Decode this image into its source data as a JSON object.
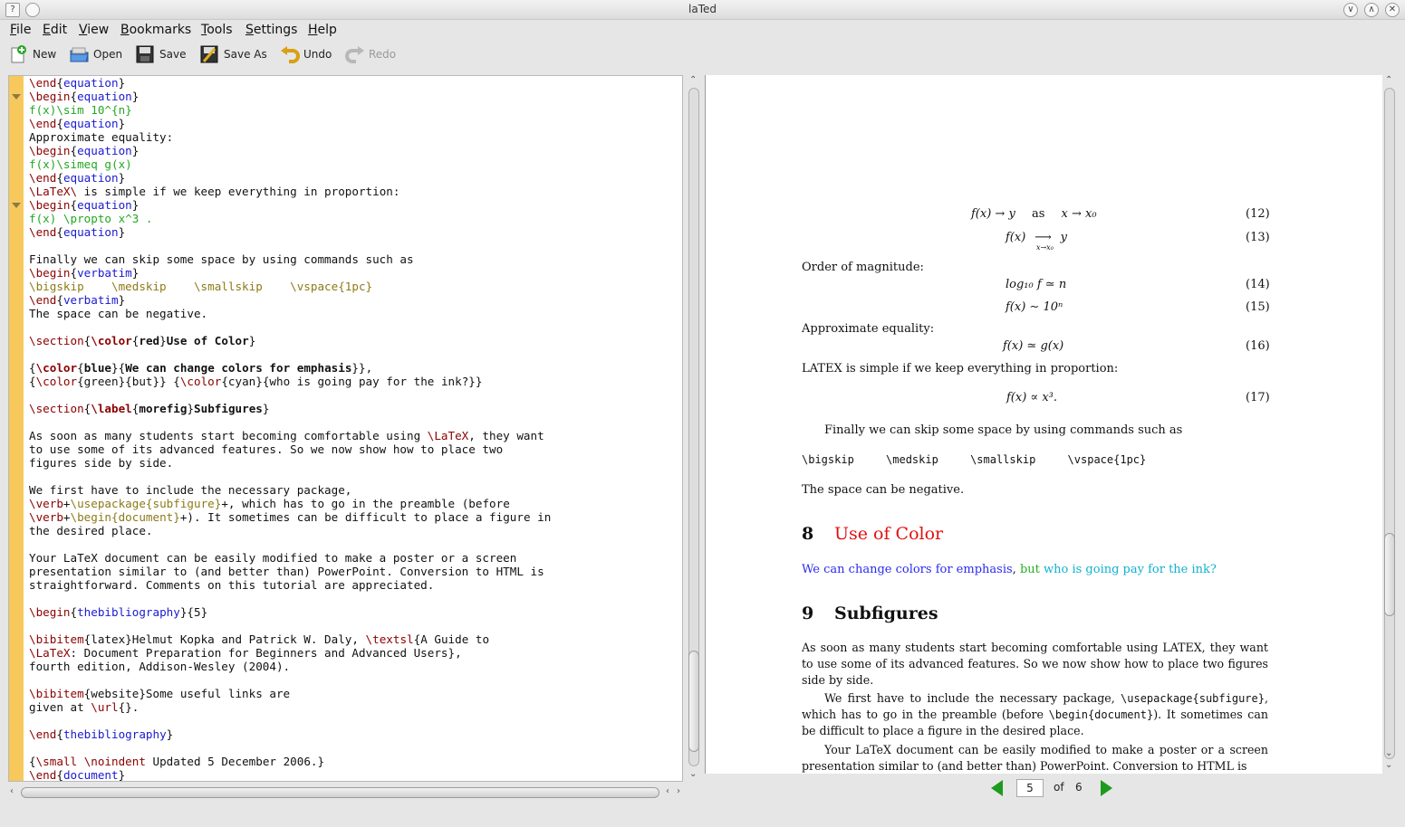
{
  "window": {
    "title": "laTed"
  },
  "titlebar_buttons": {
    "help": "?",
    "minimize": "∨",
    "maximize": "∧",
    "close": "✕"
  },
  "menubar": [
    {
      "mnemonic": "F",
      "rest": "ile"
    },
    {
      "mnemonic": "E",
      "rest": "dit"
    },
    {
      "mnemonic": "V",
      "rest": "iew"
    },
    {
      "mnemonic": "B",
      "rest": "ookmarks"
    },
    {
      "mnemonic": "T",
      "rest": "ools"
    },
    {
      "mnemonic": "S",
      "rest": "ettings"
    },
    {
      "mnemonic": "H",
      "rest": "elp"
    }
  ],
  "toolbar": {
    "new_label": "New",
    "open_label": "Open",
    "save_label": "Save",
    "save_as_label": "Save As",
    "undo_label": "Undo",
    "redo_label": "Redo",
    "icons": [
      "new-document-icon",
      "open-folder-icon",
      "save-disk-icon",
      "save-as-icon",
      "undo-arrow-icon",
      "redo-arrow-icon"
    ]
  },
  "editor": {
    "fold_markers_at_lines": [
      1,
      9
    ],
    "lines": [
      [
        {
          "t": "\\end",
          "c": "cmd"
        },
        {
          "t": "{"
        },
        {
          "t": "equation",
          "c": "arg"
        },
        {
          "t": "}"
        }
      ],
      [
        {
          "t": "\\begin",
          "c": "cmd"
        },
        {
          "t": "{"
        },
        {
          "t": "equation",
          "c": "arg"
        },
        {
          "t": "}"
        }
      ],
      [
        {
          "t": "f(x)\\sim 10^{n}",
          "c": "mat"
        }
      ],
      [
        {
          "t": "\\end",
          "c": "cmd"
        },
        {
          "t": "{"
        },
        {
          "t": "equation",
          "c": "arg"
        },
        {
          "t": "}"
        }
      ],
      [
        {
          "t": "Approximate equality:"
        }
      ],
      [
        {
          "t": "\\begin",
          "c": "cmd"
        },
        {
          "t": "{"
        },
        {
          "t": "equation",
          "c": "arg"
        },
        {
          "t": "}"
        }
      ],
      [
        {
          "t": "f(x)\\simeq g(x)",
          "c": "mat"
        }
      ],
      [
        {
          "t": "\\end",
          "c": "cmd"
        },
        {
          "t": "{"
        },
        {
          "t": "equation",
          "c": "arg"
        },
        {
          "t": "}"
        }
      ],
      [
        {
          "t": "\\LaTeX\\",
          "c": "cmd"
        },
        {
          "t": " is simple if we keep everything in proportion:"
        }
      ],
      [
        {
          "t": "\\begin",
          "c": "cmd"
        },
        {
          "t": "{"
        },
        {
          "t": "equation",
          "c": "arg"
        },
        {
          "t": "}"
        }
      ],
      [
        {
          "t": "f(x) \\propto x^3 .",
          "c": "mat"
        }
      ],
      [
        {
          "t": "\\end",
          "c": "cmd"
        },
        {
          "t": "{"
        },
        {
          "t": "equation",
          "c": "arg"
        },
        {
          "t": "}"
        }
      ],
      [
        {
          "t": ""
        }
      ],
      [
        {
          "t": "Finally we can skip some space by using commands such as"
        }
      ],
      [
        {
          "t": "\\begin",
          "c": "cmd"
        },
        {
          "t": "{"
        },
        {
          "t": "verbatim",
          "c": "arg"
        },
        {
          "t": "}"
        }
      ],
      [
        {
          "t": "\\bigskip    \\medskip    \\smallskip    \\vspace{1pc}",
          "c": "opt"
        }
      ],
      [
        {
          "t": "\\end",
          "c": "cmd"
        },
        {
          "t": "{"
        },
        {
          "t": "verbatim",
          "c": "arg"
        },
        {
          "t": "}"
        }
      ],
      [
        {
          "t": "The space can be negative."
        }
      ],
      [
        {
          "t": ""
        }
      ],
      [
        {
          "t": "\\section",
          "c": "cmd"
        },
        {
          "t": "{"
        },
        {
          "t": "\\color",
          "c": "cmd bold"
        },
        {
          "t": "{"
        },
        {
          "t": "red",
          "c": "bold"
        },
        {
          "t": "}"
        },
        {
          "t": "Use of Color",
          "c": "bold"
        },
        {
          "t": "}"
        }
      ],
      [
        {
          "t": ""
        }
      ],
      [
        {
          "t": "{"
        },
        {
          "t": "\\color",
          "c": "cmd bold"
        },
        {
          "t": "{"
        },
        {
          "t": "blue",
          "c": "bold"
        },
        {
          "t": "}{"
        },
        {
          "t": "We can change colors for emphasis",
          "c": "bold"
        },
        {
          "t": "}},"
        }
      ],
      [
        {
          "t": "{"
        },
        {
          "t": "\\color",
          "c": "cmd"
        },
        {
          "t": "{green}{but}} {"
        },
        {
          "t": "\\color",
          "c": "cmd"
        },
        {
          "t": "{cyan}{who is going pay for the ink?}}"
        }
      ],
      [
        {
          "t": ""
        }
      ],
      [
        {
          "t": "\\section",
          "c": "cmd"
        },
        {
          "t": "{"
        },
        {
          "t": "\\label",
          "c": "cmd bold"
        },
        {
          "t": "{"
        },
        {
          "t": "morefig",
          "c": "bold"
        },
        {
          "t": "}"
        },
        {
          "t": "Subfigures",
          "c": "bold"
        },
        {
          "t": "}"
        }
      ],
      [
        {
          "t": ""
        }
      ],
      [
        {
          "t": "As soon as many students start becoming comfortable using "
        },
        {
          "t": "\\LaTeX",
          "c": "cmd"
        },
        {
          "t": ", they want"
        }
      ],
      [
        {
          "t": "to use some of its advanced features. So we now show how to place two"
        }
      ],
      [
        {
          "t": "figures side by side."
        }
      ],
      [
        {
          "t": ""
        }
      ],
      [
        {
          "t": "We first have to include the necessary package,"
        }
      ],
      [
        {
          "t": "\\verb",
          "c": "cmd"
        },
        {
          "t": "+"
        },
        {
          "t": "\\usepackage{subfigure}",
          "c": "opt"
        },
        {
          "t": "+, which has to go in the preamble (before"
        }
      ],
      [
        {
          "t": "\\verb",
          "c": "cmd"
        },
        {
          "t": "+"
        },
        {
          "t": "\\begin{document}",
          "c": "opt"
        },
        {
          "t": "+). It sometimes can be difficult to place a figure in"
        }
      ],
      [
        {
          "t": "the desired place."
        }
      ],
      [
        {
          "t": ""
        }
      ],
      [
        {
          "t": "Your LaTeX document can be easily modified to make a poster or a screen"
        }
      ],
      [
        {
          "t": "presentation similar to (and better than) PowerPoint. Conversion to HTML is"
        }
      ],
      [
        {
          "t": "straightforward. Comments on this tutorial are appreciated."
        }
      ],
      [
        {
          "t": ""
        }
      ],
      [
        {
          "t": "\\begin",
          "c": "cmd"
        },
        {
          "t": "{"
        },
        {
          "t": "thebibliography",
          "c": "arg"
        },
        {
          "t": "}{5}"
        }
      ],
      [
        {
          "t": ""
        }
      ],
      [
        {
          "t": "\\bibitem",
          "c": "cmd"
        },
        {
          "t": "{latex}Helmut Kopka and Patrick W. Daly, "
        },
        {
          "t": "\\textsl",
          "c": "cmd"
        },
        {
          "t": "{A Guide to"
        }
      ],
      [
        {
          "t": "\\LaTeX",
          "c": "cmd"
        },
        {
          "t": ": Document Preparation for Beginners and Advanced Users},"
        }
      ],
      [
        {
          "t": "fourth edition, Addison-Wesley (2004)."
        }
      ],
      [
        {
          "t": ""
        }
      ],
      [
        {
          "t": "\\bibitem",
          "c": "cmd"
        },
        {
          "t": "{website}Some useful links are"
        }
      ],
      [
        {
          "t": "given at "
        },
        {
          "t": "\\url",
          "c": "cmd"
        },
        {
          "t": "{}."
        }
      ],
      [
        {
          "t": ""
        }
      ],
      [
        {
          "t": "\\end",
          "c": "cmd"
        },
        {
          "t": "{"
        },
        {
          "t": "thebibliography",
          "c": "arg"
        },
        {
          "t": "}"
        }
      ],
      [
        {
          "t": ""
        }
      ],
      [
        {
          "t": "{"
        },
        {
          "t": "\\small",
          "c": "cmd"
        },
        {
          "t": " "
        },
        {
          "t": "\\noindent",
          "c": "cmd"
        },
        {
          "t": " Updated 5 December 2006.}"
        }
      ],
      [
        {
          "t": "\\end",
          "c": "cmd"
        },
        {
          "t": "{"
        },
        {
          "t": "document",
          "c": "arg"
        },
        {
          "t": "}"
        }
      ]
    ]
  },
  "preview": {
    "eq12": {
      "lhs": "f(x) → y",
      "mid": "as",
      "rhs": "x → x₀",
      "num": "(12)"
    },
    "eq13": {
      "lhs": "f(x)",
      "arrow": "⟶",
      "under": "x→x₀",
      "rhs": "y",
      "num": "(13)"
    },
    "order_of_magnitude": "Order of magnitude:",
    "eq14": {
      "text": "log₁₀ f ≃ n",
      "num": "(14)"
    },
    "eq15": {
      "text": "f(x) ∼ 10ⁿ",
      "num": "(15)"
    },
    "approximate_equality": "Approximate equality:",
    "eq16": {
      "text": "f(x) ≃ g(x)",
      "num": "(16)"
    },
    "latex_simple": "LATEX is simple if we keep everything in proportion:",
    "eq17": {
      "text": "f(x) ∝ x³.",
      "num": "(17)"
    },
    "finally": "Finally we can skip some space by using commands such as",
    "verbatim": [
      "\\bigskip",
      "\\medskip",
      "\\smallskip",
      "\\vspace{1pc}"
    ],
    "negative": "The space can be negative.",
    "section8": {
      "number": "8",
      "title": "Use of Color"
    },
    "color_line": {
      "blue": "We can change colors for emphasis",
      "comma": ",",
      "green": "but",
      "cyan": "who is going pay for the ink?"
    },
    "section9": {
      "number": "9",
      "title": "Subfigures"
    },
    "para1": "As soon as many students start becoming comfortable using LATEX, they want to use some of its advanced features. So we now show how to place two figures side by side.",
    "para2_a": "We first have to include the necessary package, ",
    "para2_code1": "\\usepackage{subfigure}",
    "para2_b": ", which has to go in the preamble (before ",
    "para2_code2": "\\begin{document}",
    "para2_c": "). It sometimes can be difficult to place a figure in the desired place.",
    "para3": "Your LaTeX document can be easily modified to make a poster or a screen presentation similar to (and better than) PowerPoint. Conversion to HTML is"
  },
  "pagenav": {
    "current": "5",
    "of": "of",
    "total": "6"
  }
}
